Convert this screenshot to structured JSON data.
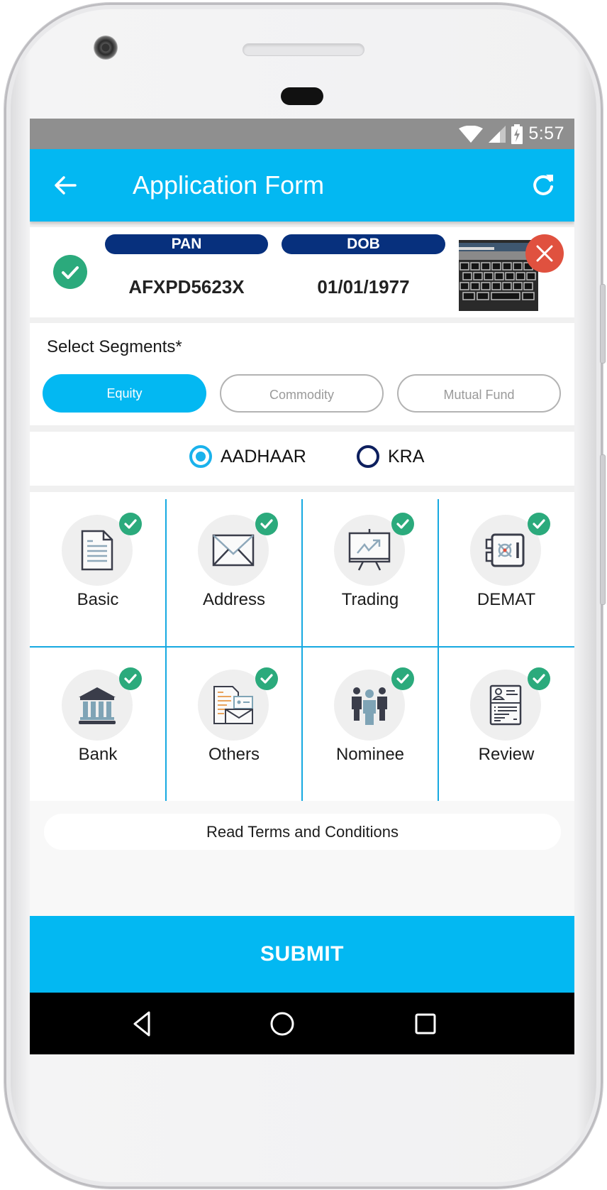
{
  "status_bar": {
    "time": "5:57",
    "icons": [
      "wifi-icon",
      "signal-icon",
      "battery-charging-icon"
    ]
  },
  "app_bar": {
    "title": "Application Form",
    "back_icon": "arrow-left-icon",
    "refresh_icon": "refresh-icon"
  },
  "identity": {
    "verified_icon": "check-circle-icon",
    "pan_label": "PAN",
    "pan_value": "AFXPD5623X",
    "dob_label": "DOB",
    "dob_value": "01/01/1977",
    "photo": "document-photo-keyboard",
    "remove_icon": "close-icon"
  },
  "segments": {
    "title": "Select Segments*",
    "options": [
      {
        "label": "Equity",
        "selected": true
      },
      {
        "label": "Commodity",
        "selected": false
      },
      {
        "label": "Mutual Fund",
        "selected": false
      }
    ]
  },
  "kyc_source": {
    "options": [
      {
        "label": "AADHAAR",
        "selected": true
      },
      {
        "label": "KRA",
        "selected": false
      }
    ]
  },
  "sections": [
    {
      "label": "Basic",
      "icon": "document-icon",
      "completed": true
    },
    {
      "label": "Address",
      "icon": "envelope-icon",
      "completed": true
    },
    {
      "label": "Trading",
      "icon": "presentation-chart-icon",
      "completed": true
    },
    {
      "label": "DEMAT",
      "icon": "safe-vault-icon",
      "completed": true
    },
    {
      "label": "Bank",
      "icon": "bank-icon",
      "completed": true
    },
    {
      "label": "Others",
      "icon": "documents-mail-icon",
      "completed": true
    },
    {
      "label": "Nominee",
      "icon": "people-group-icon",
      "completed": true
    },
    {
      "label": "Review",
      "icon": "id-card-icon",
      "completed": true
    }
  ],
  "terms_label": "Read Terms and Conditions",
  "submit_label": "SUBMIT",
  "colors": {
    "primary": "#03b8f2",
    "navy": "#07307d",
    "success": "#2baa7c",
    "danger": "#e0513f",
    "status_bar": "#8f8f8f"
  },
  "nav_bar": {
    "buttons": [
      "back-triangle-icon",
      "home-circle-icon",
      "recents-square-icon"
    ]
  }
}
